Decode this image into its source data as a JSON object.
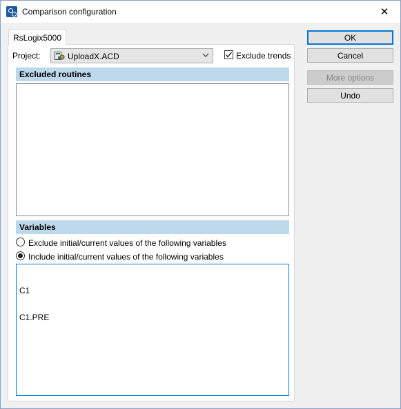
{
  "window": {
    "title": "Comparison configuration",
    "icon": "app-config-icon",
    "close_glyph": "✕"
  },
  "tab": {
    "label": "RsLogix5000"
  },
  "project": {
    "label": "Project:",
    "value": "UploadX.ACD",
    "file_icon": "acd-file-icon",
    "exclude_trends_label": "Exclude trends",
    "exclude_trends_checked": true
  },
  "excluded_routines": {
    "header": "Excluded routines",
    "items": []
  },
  "variables": {
    "header": "Variables",
    "options": [
      {
        "label": "Exclude initial/current values of the following variables",
        "selected": false
      },
      {
        "label": "Include initial/current values of the following variables",
        "selected": true
      }
    ],
    "entries": [
      "C1",
      "C1.PRE"
    ]
  },
  "buttons": {
    "ok": "OK",
    "cancel": "Cancel",
    "more_options": "More options",
    "undo": "Undo"
  },
  "colors": {
    "section_header": "#bdd8ea",
    "focus_border": "#0078d7"
  }
}
